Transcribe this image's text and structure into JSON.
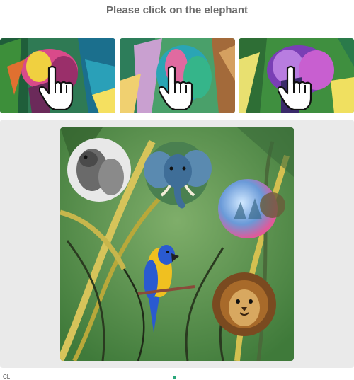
{
  "prompt": {
    "text": "Please click on the elephant",
    "color": "#6b6b6b"
  },
  "example_tiles": [
    {
      "icon": "pointer-hand-icon",
      "subject": "elephant"
    },
    {
      "icon": "pointer-hand-icon",
      "subject": "elephant"
    },
    {
      "icon": "pointer-hand-icon",
      "subject": "elephant"
    }
  ],
  "challenge": {
    "background_color": "#5f8f4e",
    "panel_color": "#eaeaea",
    "items": [
      "squirrel",
      "elephant",
      "orb",
      "parrot",
      "lion"
    ]
  },
  "footer": {
    "text": "CL",
    "accent_color": "#2aa77a"
  }
}
